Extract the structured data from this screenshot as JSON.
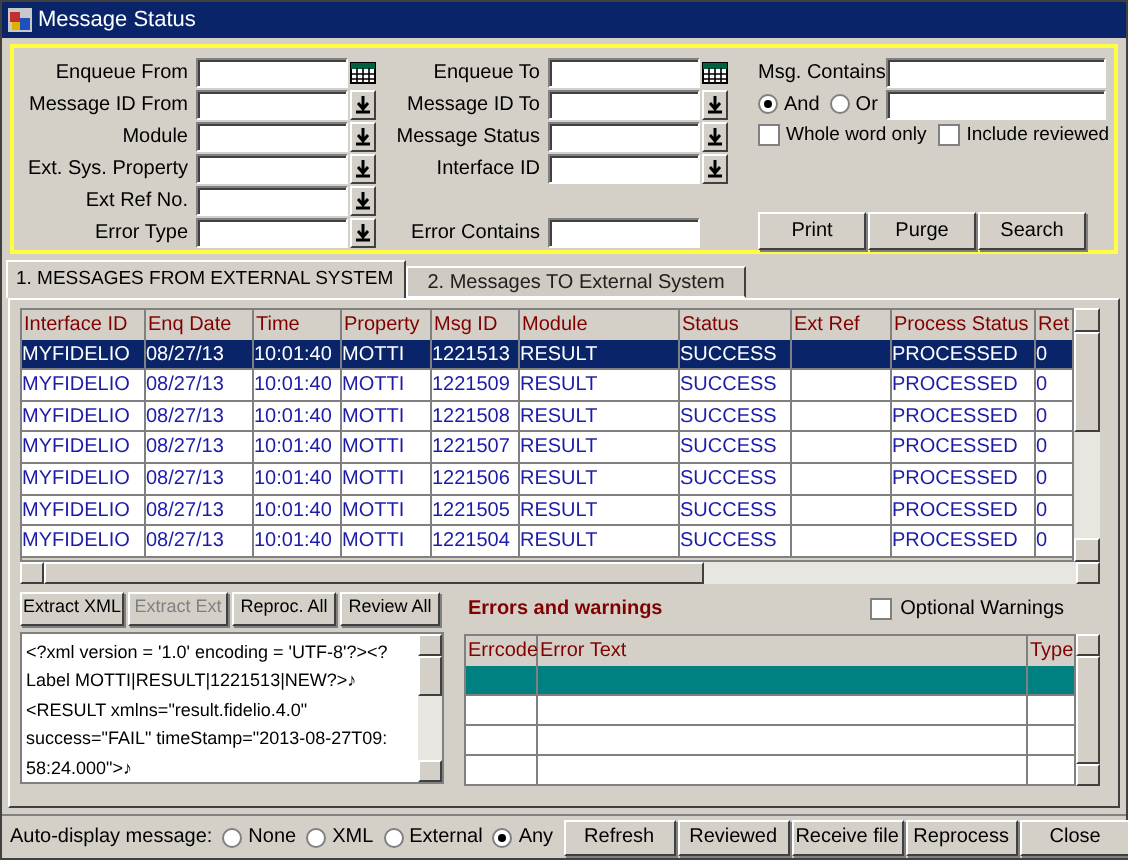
{
  "window": {
    "title": "Message Status"
  },
  "filters": {
    "left": [
      {
        "label": "Enqueue From",
        "kind": "date"
      },
      {
        "label": "Message ID From",
        "kind": "dropdown"
      },
      {
        "label": "Module",
        "kind": "dropdown"
      },
      {
        "label": "Ext. Sys. Property",
        "kind": "dropdown"
      },
      {
        "label": "Ext Ref No.",
        "kind": "dropdown"
      },
      {
        "label": "Error Type",
        "kind": "dropdown"
      }
    ],
    "middle": [
      {
        "label": "Enqueue To",
        "kind": "date"
      },
      {
        "label": "Message ID To",
        "kind": "dropdown"
      },
      {
        "label": "Message Status",
        "kind": "dropdown"
      },
      {
        "label": "Interface ID",
        "kind": "dropdown"
      },
      {
        "label": "Error Contains",
        "kind": "text"
      }
    ],
    "msg_contains": {
      "label": "Msg. Contains"
    },
    "match": [
      {
        "label": "And",
        "selected": true
      },
      {
        "label": "Or",
        "selected": false
      }
    ],
    "options": [
      {
        "label": "Whole word only",
        "checked": false
      },
      {
        "label": "Include reviewed",
        "checked": false
      }
    ],
    "buttons": [
      "Print",
      "Purge",
      "Search"
    ]
  },
  "tabs": [
    {
      "label": "1. MESSAGES FROM EXTERNAL SYSTEM",
      "selected": true
    },
    {
      "label": "2. Messages TO External System",
      "selected": false
    }
  ],
  "table": {
    "columns": [
      "Interface ID",
      "Enq Date",
      "Time",
      "Property",
      "Msg ID",
      "Module",
      "Status",
      "Ext Ref",
      "Process Status",
      "Ret"
    ],
    "rows": [
      {
        "selected": true,
        "cells": [
          "MYFIDELIO",
          "08/27/13",
          "10:01:40",
          "MOTTI",
          "1221513",
          "RESULT",
          "SUCCESS",
          "",
          "PROCESSED",
          "0"
        ]
      },
      {
        "selected": false,
        "cells": [
          "MYFIDELIO",
          "08/27/13",
          "10:01:40",
          "MOTTI",
          "1221509",
          "RESULT",
          "SUCCESS",
          "",
          "PROCESSED",
          "0"
        ]
      },
      {
        "selected": false,
        "cells": [
          "MYFIDELIO",
          "08/27/13",
          "10:01:40",
          "MOTTI",
          "1221508",
          "RESULT",
          "SUCCESS",
          "",
          "PROCESSED",
          "0"
        ]
      },
      {
        "selected": false,
        "cells": [
          "MYFIDELIO",
          "08/27/13",
          "10:01:40",
          "MOTTI",
          "1221507",
          "RESULT",
          "SUCCESS",
          "",
          "PROCESSED",
          "0"
        ]
      },
      {
        "selected": false,
        "cells": [
          "MYFIDELIO",
          "08/27/13",
          "10:01:40",
          "MOTTI",
          "1221506",
          "RESULT",
          "SUCCESS",
          "",
          "PROCESSED",
          "0"
        ]
      },
      {
        "selected": false,
        "cells": [
          "MYFIDELIO",
          "08/27/13",
          "10:01:40",
          "MOTTI",
          "1221505",
          "RESULT",
          "SUCCESS",
          "",
          "PROCESSED",
          "0"
        ]
      },
      {
        "selected": false,
        "cells": [
          "MYFIDELIO",
          "08/27/13",
          "10:01:40",
          "MOTTI",
          "1221504",
          "RESULT",
          "SUCCESS",
          "",
          "PROCESSED",
          "0"
        ]
      }
    ]
  },
  "message_buttons": [
    {
      "label": "Extract XML",
      "disabled": false
    },
    {
      "label": "Extract Ext",
      "disabled": true
    },
    {
      "label": "Reproc. All",
      "disabled": false
    },
    {
      "label": "Review All",
      "disabled": false
    }
  ],
  "message_text": [
    "<?xml version = '1.0' encoding = 'UTF-8'?><?",
    "Label MOTTI|RESULT|1221513|NEW?>♪",
    "<RESULT xmlns=\"result.fidelio.4.0\"",
    "success=\"FAIL\" timeStamp=\"2013-08-27T09:",
    "58:24.000\">♪"
  ],
  "errors": {
    "title": "Errors and warnings",
    "optional_warnings": {
      "label": "Optional Warnings",
      "checked": false
    },
    "columns": [
      "Errcode",
      "Error Text",
      "Type"
    ],
    "rows": [
      {
        "selected": true
      },
      {
        "selected": false
      },
      {
        "selected": false
      },
      {
        "selected": false
      }
    ]
  },
  "auto_display": {
    "label": "Auto-display message:",
    "options": [
      {
        "label": "None",
        "selected": false
      },
      {
        "label": "XML",
        "selected": false
      },
      {
        "label": "External",
        "selected": false
      },
      {
        "label": "Any",
        "selected": true
      }
    ]
  },
  "bottom_buttons": [
    "Refresh",
    "Reviewed",
    "Receive file",
    "Reprocess",
    "Close"
  ]
}
